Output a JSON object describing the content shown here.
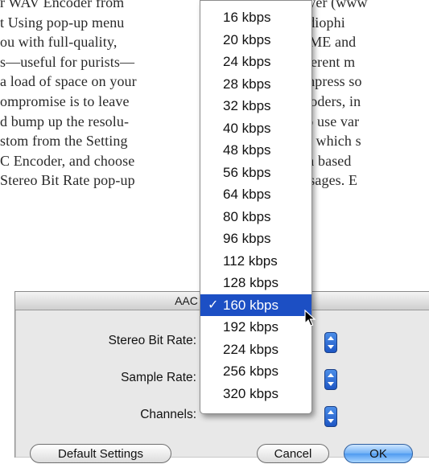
{
  "book": {
    "left_lines": [
      "r WAV Encoder from",
      "t Using pop-up menu",
      "ou with full-quality,",
      "s—useful for purists—",
      "a load of space on your",
      "ompromise is to leave",
      "d bump up the resolu-",
      "stom from the Setting",
      "C Encoder, and choose",
      "Stereo Bit Rate pop-up"
    ],
    "right_lines": [
      "Player (www",
      "  Audiophi",
      "LAME and",
      "different m",
      "compress so",
      "encoders, in",
      "also use var",
      "ing, which s",
      "sion based",
      "passages. E"
    ]
  },
  "dialog": {
    "title": "AAC",
    "fields": [
      {
        "label": "Stereo Bit Rate:"
      },
      {
        "label": "Sample Rate:"
      },
      {
        "label": "Channels:"
      }
    ],
    "buttons": {
      "default": "Default Settings",
      "cancel": "Cancel",
      "ok": "OK"
    }
  },
  "menu": {
    "items": [
      "16 kbps",
      "20 kbps",
      "24 kbps",
      "28 kbps",
      "32 kbps",
      "40 kbps",
      "48 kbps",
      "56 kbps",
      "64 kbps",
      "80 kbps",
      "96 kbps",
      "112 kbps",
      "128 kbps",
      "160 kbps",
      "192 kbps",
      "224 kbps",
      "256 kbps",
      "320 kbps"
    ],
    "selected_index": 13,
    "check_glyph": "✓",
    "selection_color": "#1c4fc4"
  }
}
